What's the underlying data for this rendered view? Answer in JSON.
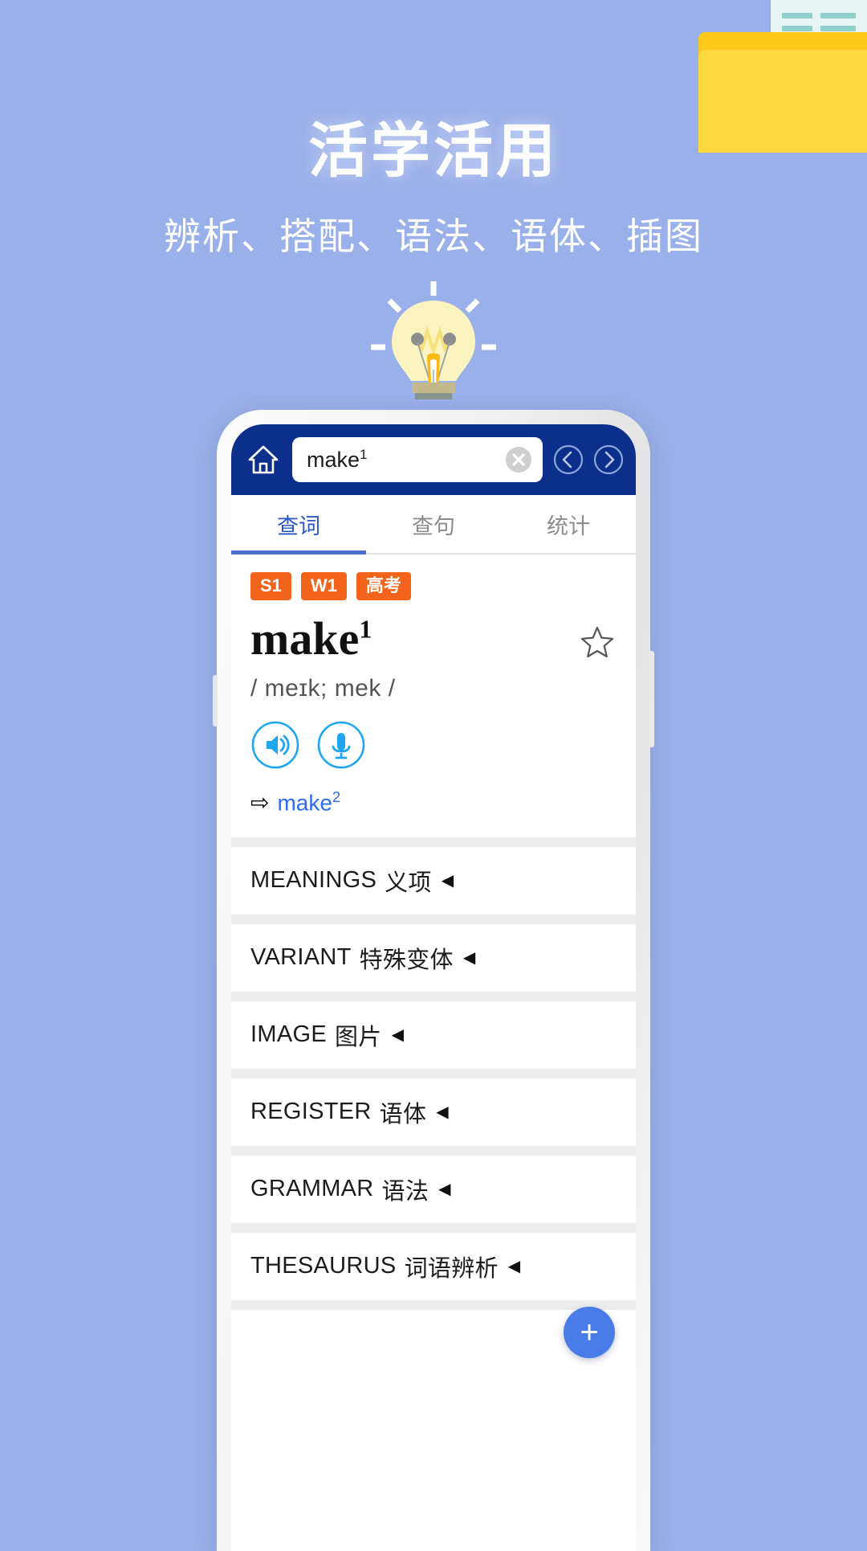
{
  "promo": {
    "headline": "活学活用",
    "subhead": "辨析、搭配、语法、语体、插图",
    "bg_color": "#9ab0ea",
    "headline_color": "#ffffff",
    "folder_color": "#ffd83d",
    "bulb_color": "#fbf3c0"
  },
  "app": {
    "appbar": {
      "bg_color": "#0b2f8a",
      "home_icon": "home-icon",
      "back_icon": "chevron-left-circle-icon",
      "forward_icon": "chevron-right-circle-icon"
    },
    "search": {
      "value": "make",
      "superscript": "1",
      "clear_icon": "close-circle-icon"
    },
    "tabs": [
      {
        "label": "查词",
        "active": true
      },
      {
        "label": "查句",
        "active": false
      },
      {
        "label": "统计",
        "active": false
      }
    ],
    "entry": {
      "badges": [
        "S1",
        "W1",
        "高考"
      ],
      "badge_color": "#f2641b",
      "headword": "make",
      "headword_sup": "1",
      "phonetic": "/ meɪk; mek /",
      "star_icon": "star-outline-icon",
      "speaker_icon": "speaker-icon",
      "mic_icon": "microphone-icon",
      "accent_color": "#1ea7f0",
      "xref_arrow": "⇨",
      "xref_label": "make",
      "xref_sup": "2",
      "xref_color": "#2b6cf0"
    },
    "sections": [
      {
        "en": "MEANINGS",
        "cn": "义项",
        "arrow": "◀"
      },
      {
        "en": "VARIANT",
        "cn": "特殊变体",
        "arrow": "◀"
      },
      {
        "en": "IMAGE",
        "cn": "图片",
        "arrow": "◀"
      },
      {
        "en": "REGISTER",
        "cn": "语体",
        "arrow": "◀"
      },
      {
        "en": "GRAMMAR",
        "cn": "语法",
        "arrow": "◀"
      },
      {
        "en": "THESAURUS",
        "cn": "词语辨析",
        "arrow": "◀"
      }
    ],
    "fab": {
      "label": "+",
      "color": "#4a7ce8"
    }
  }
}
